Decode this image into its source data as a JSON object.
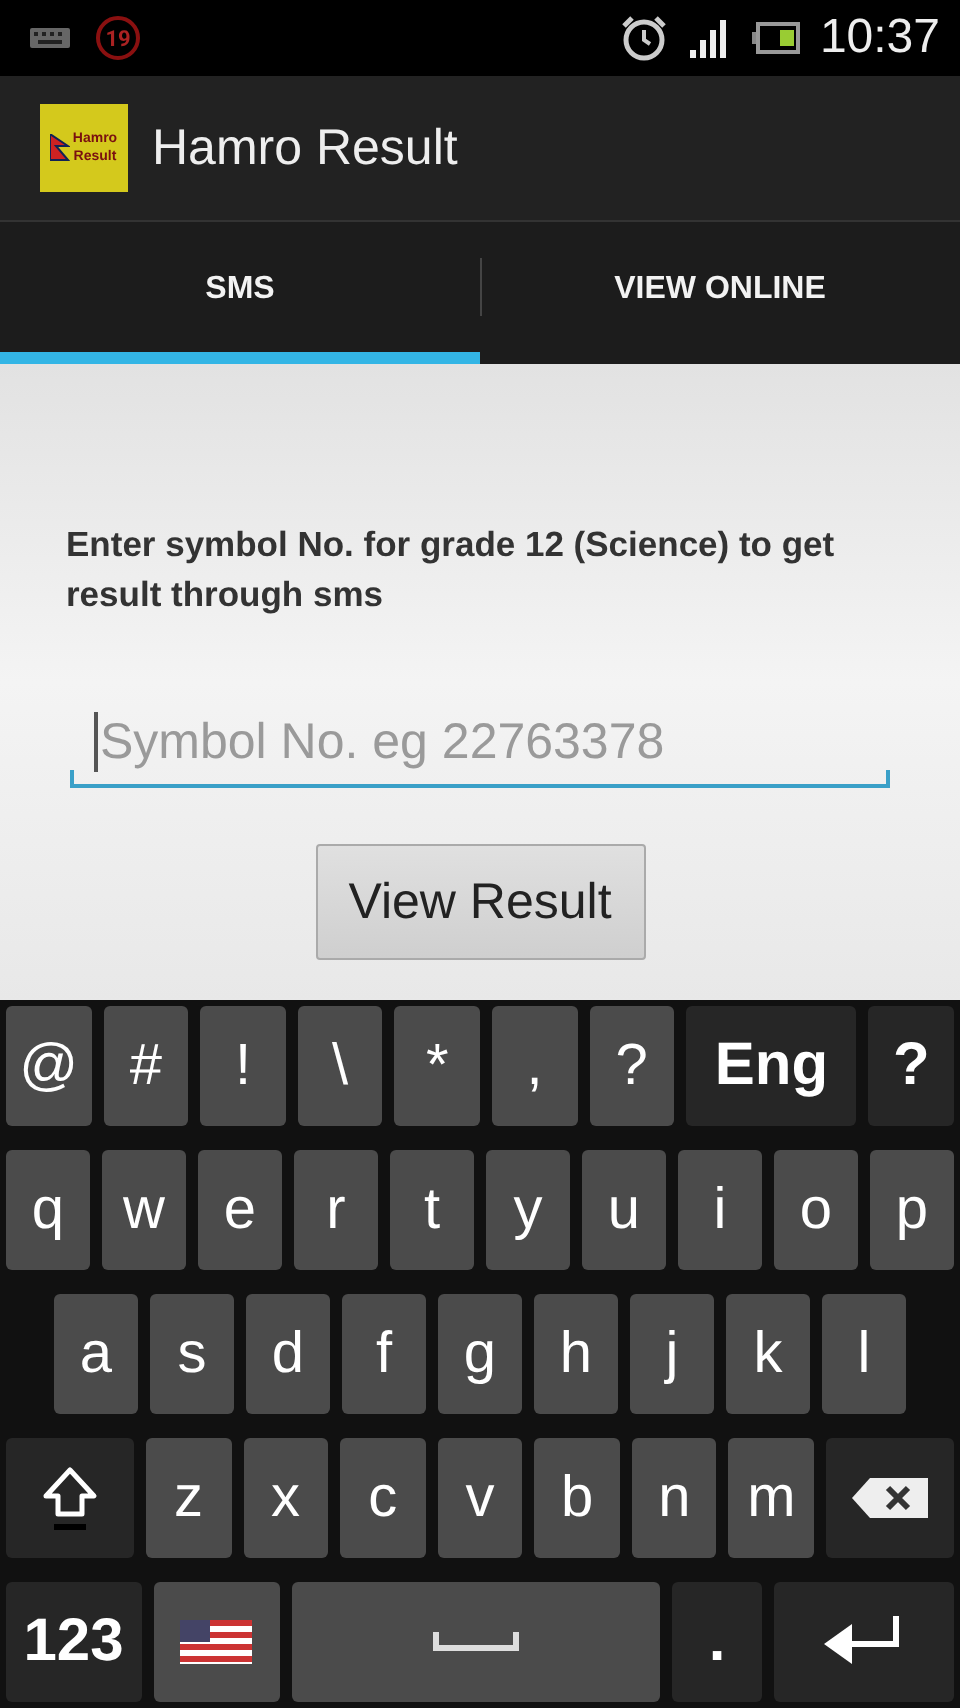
{
  "status_bar": {
    "notification_count": "19",
    "time": "10:37"
  },
  "action_bar": {
    "logo_lines": [
      "Hamro",
      "Result"
    ],
    "title": "Hamro Result"
  },
  "tabs": [
    {
      "label": "SMS",
      "selected": true
    },
    {
      "label": "VIEW ONLINE",
      "selected": false
    }
  ],
  "form": {
    "instruction": "Enter symbol No. for grade 12 (Science) to get result through sms",
    "field": {
      "placeholder": "Symbol No. eg 22763378"
    },
    "button": "View Result"
  },
  "keyboard": {
    "rows": [
      {
        "keys": [
          {
            "kind": "char",
            "label": "@"
          },
          {
            "kind": "char",
            "label": "#"
          },
          {
            "kind": "char",
            "label": "!"
          },
          {
            "kind": "char",
            "label": "\\"
          },
          {
            "kind": "char",
            "label": "*"
          },
          {
            "kind": "char",
            "label": ","
          },
          {
            "kind": "char",
            "label": "?"
          },
          {
            "kind": "language",
            "label": "Eng"
          },
          {
            "kind": "function",
            "label": "?"
          }
        ]
      },
      {
        "keys": [
          {
            "kind": "char",
            "label": "q"
          },
          {
            "kind": "char",
            "label": "w"
          },
          {
            "kind": "char",
            "label": "e"
          },
          {
            "kind": "char",
            "label": "r"
          },
          {
            "kind": "char",
            "label": "t"
          },
          {
            "kind": "char",
            "label": "y"
          },
          {
            "kind": "char",
            "label": "u"
          },
          {
            "kind": "char",
            "label": "i"
          },
          {
            "kind": "char",
            "label": "o"
          },
          {
            "kind": "char",
            "label": "p"
          }
        ]
      },
      {
        "keys": [
          {
            "kind": "char",
            "label": "a"
          },
          {
            "kind": "char",
            "label": "s"
          },
          {
            "kind": "char",
            "label": "d"
          },
          {
            "kind": "char",
            "label": "f"
          },
          {
            "kind": "char",
            "label": "g"
          },
          {
            "kind": "char",
            "label": "h"
          },
          {
            "kind": "char",
            "label": "j"
          },
          {
            "kind": "char",
            "label": "k"
          },
          {
            "kind": "char",
            "label": "l"
          }
        ]
      },
      {
        "keys": [
          {
            "kind": "shift"
          },
          {
            "kind": "char",
            "label": "z"
          },
          {
            "kind": "char",
            "label": "x"
          },
          {
            "kind": "char",
            "label": "c"
          },
          {
            "kind": "char",
            "label": "v"
          },
          {
            "kind": "char",
            "label": "b"
          },
          {
            "kind": "char",
            "label": "n"
          },
          {
            "kind": "char",
            "label": "m"
          },
          {
            "kind": "backspace"
          }
        ]
      },
      {
        "keys": [
          {
            "kind": "symbols",
            "label": "123"
          },
          {
            "kind": "flag"
          },
          {
            "kind": "space"
          },
          {
            "kind": "function",
            "label": "."
          },
          {
            "kind": "enter"
          }
        ]
      }
    ]
  }
}
